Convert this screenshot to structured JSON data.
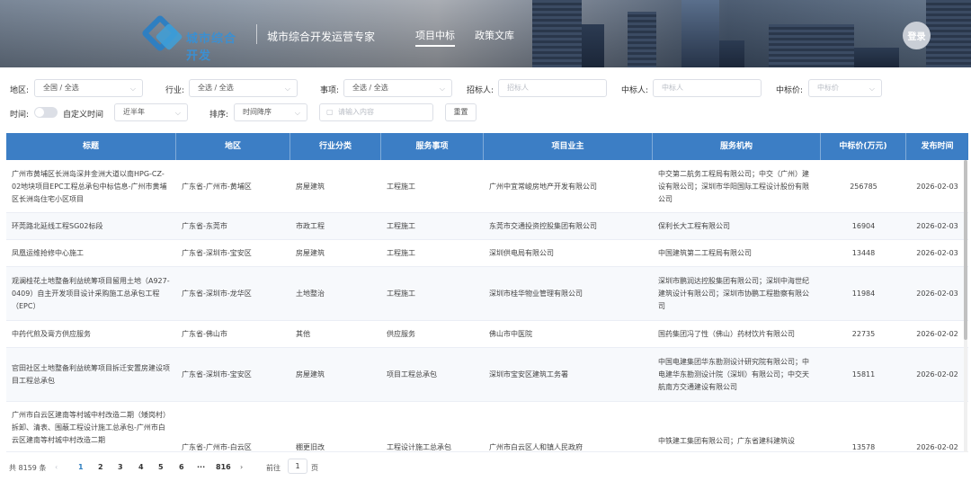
{
  "header": {
    "logo_text": "城市综合开发",
    "slogan": "城市综合开发运营专家",
    "nav": [
      {
        "label": "项目中标",
        "active": true
      },
      {
        "label": "政策文库",
        "active": false
      }
    ],
    "login": "登录"
  },
  "filters": {
    "region": {
      "label": "地区:",
      "value": "全国 / 全选"
    },
    "industry": {
      "label": "行业:",
      "value": "全选 / 全选"
    },
    "matter": {
      "label": "事项:",
      "value": "全选 / 全选"
    },
    "tenderer": {
      "label": "招标人:",
      "placeholder": "招标人"
    },
    "winner": {
      "label": "中标人:",
      "placeholder": "中标人"
    },
    "price": {
      "label": "中标价:",
      "placeholder": "中标价"
    },
    "time": {
      "label": "时间:",
      "custom_label": "自定义时间",
      "value": "近半年"
    },
    "sort": {
      "label": "排序:",
      "value": "时间降序"
    },
    "search": {
      "placeholder": "请输入内容"
    },
    "reset": "重置"
  },
  "table": {
    "headers": [
      "标题",
      "地区",
      "行业分类",
      "服务事项",
      "项目业主",
      "服务机构",
      "中标价(万元)",
      "发布时间"
    ],
    "rows": [
      {
        "title": "广州市黄埔区长洲岛深井金洲大道以南HPG-CZ-02地块项目EPC工程总承包中标信息-广州市黄埔区长洲岛住宅小区项目",
        "region": "广东省-广州市-黄埔区",
        "industry": "房屋建筑",
        "service": "工程施工",
        "owner": "广州中宜常峻房地产开发有限公司",
        "agency": "中交第二航务工程局有限公司；中交（广州）建设有限公司；深圳市华阳国际工程设计股份有限公司",
        "price": "256785",
        "date": "2026-02-03"
      },
      {
        "title": "环莞路北延线工程SG02标段",
        "region": "广东省-东莞市",
        "industry": "市政工程",
        "service": "工程施工",
        "owner": "东莞市交通投资控股集团有限公司",
        "agency": "保利长大工程有限公司",
        "price": "16904",
        "date": "2026-02-03"
      },
      {
        "title": "凤凰运维抢修中心施工",
        "region": "广东省-深圳市-宝安区",
        "industry": "房屋建筑",
        "service": "工程施工",
        "owner": "深圳供电局有限公司",
        "agency": "中国建筑第二工程局有限公司",
        "price": "13448",
        "date": "2026-02-03"
      },
      {
        "title": "观澜桂花土地整备利益统筹项目留用土地（A927-0409）自主开发项目设计采购施工总承包工程（EPC）",
        "region": "广东省-深圳市-龙华区",
        "industry": "土地整治",
        "service": "工程施工",
        "owner": "深圳市桂华物业管理有限公司",
        "agency": "深圳市鹏润达控股集团有限公司；深圳中海世纪建筑设计有限公司；深圳市协鹏工程勘察有限公司",
        "price": "11984",
        "date": "2026-02-03"
      },
      {
        "title": "中药代煎及膏方供应服务",
        "region": "广东省-佛山市",
        "industry": "其他",
        "service": "供应服务",
        "owner": "佛山市中医院",
        "agency": "国药集团冯了性（佛山）药材饮片有限公司",
        "price": "22735",
        "date": "2026-02-02"
      },
      {
        "title": "官田社区土地整备利益统筹项目拆迁安置房建设项目工程总承包",
        "region": "广东省-深圳市-宝安区",
        "industry": "房屋建筑",
        "service": "项目工程总承包",
        "owner": "深圳市宝安区建筑工务署",
        "agency": "中国电建集团华东勘测设计研究院有限公司；中电建华东勘测设计院（深圳）有限公司；中交天航南方交通建设有限公司",
        "price": "15811",
        "date": "2026-02-02"
      },
      {
        "title": "广州市白云区建南等村城中村改造二期（矮岗村）拆卸、清表、围蔽工程设计施工总承包-广州市白云区建南等村城中村改造二期",
        "region": "广东省-广州市-白云区",
        "industry": "棚更旧改",
        "service": "工程设计施工总承包",
        "owner": "广州市白云区人和镇人民政府",
        "agency": "中铁建工集团有限公司；广东省建科建筑设",
        "price": "13578",
        "date": "2026-02-02"
      }
    ]
  },
  "pagination": {
    "total": "共 8159 条",
    "pages": [
      "1",
      "2",
      "3",
      "4",
      "5",
      "6"
    ],
    "ellipsis": "···",
    "last": "816",
    "goto_label": "前往",
    "goto_value": "1",
    "page_suffix": "页"
  }
}
